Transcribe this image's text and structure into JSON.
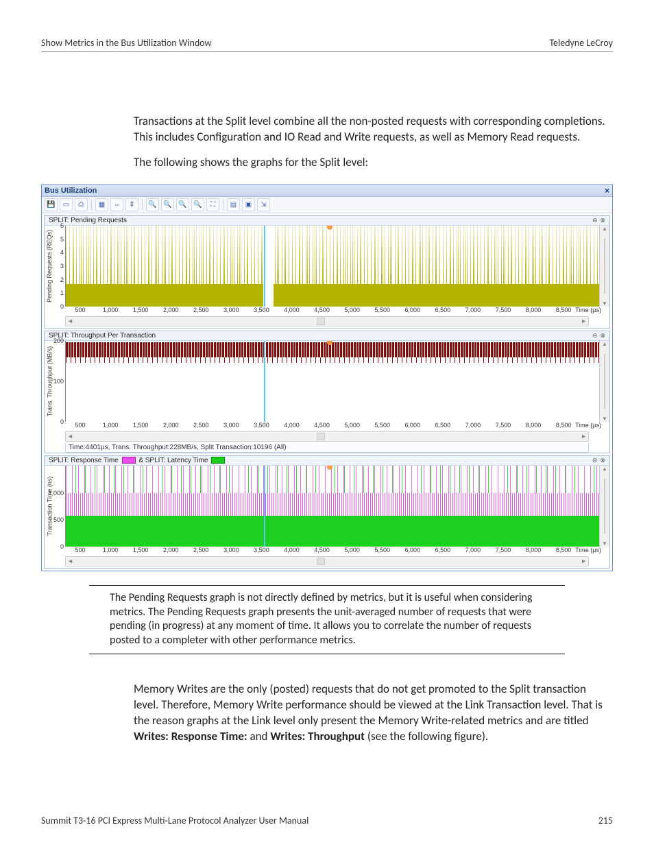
{
  "header": {
    "left": "Show Metrics in the Bus Utilization Window",
    "right": "Teledyne LeCroy"
  },
  "para1": "Transactions at the Split level combine all the non-posted requests with corresponding completions. This includes Configuration and IO Read and Write requests, as well as Memory Read requests.",
  "para2": "The following shows the graphs for the Split level:",
  "bu": {
    "window_title": "Bus Utilization",
    "toolbar_icons": [
      "save-icon",
      "rect-icon",
      "print-icon",
      "grid-icon",
      "fit-width-icon",
      "fit-height-icon",
      "zoom-in-icon",
      "zoom-out-icon",
      "zoom-select-icon",
      "zoom-reset-icon",
      "expand-icon",
      "tile-icon",
      "full-icon",
      "export-icon"
    ],
    "x_ticks": [
      "500",
      "1,000",
      "1,500",
      "2,000",
      "2,500",
      "3,000",
      "3,500",
      "4,000",
      "4,500",
      "5,000",
      "5,500",
      "6,000",
      "6,500",
      "7,000",
      "7,500",
      "8,000",
      "8,500"
    ],
    "x_label": "Time (µs)",
    "cursor_pct": 37.1,
    "marker_pct": 49.5,
    "pane1": {
      "title": "SPLIT: Pending Requests",
      "ylabel": "Pending Requests (REQs)",
      "yticks": [
        {
          "v": "0",
          "bottom": 0
        },
        {
          "v": "1",
          "bottom": 16.6
        },
        {
          "v": "2",
          "bottom": 33.3
        },
        {
          "v": "3",
          "bottom": 50
        },
        {
          "v": "4",
          "bottom": 66.6
        },
        {
          "v": "5",
          "bottom": 83.3
        },
        {
          "v": "6",
          "bottom": 100
        }
      ]
    },
    "pane2": {
      "title": "SPLIT: Throughput Per Transaction",
      "ylabel": "Trans. Throughput (MB/s)",
      "yticks": [
        {
          "v": "0",
          "bottom": 0
        },
        {
          "v": "100",
          "bottom": 50
        },
        {
          "v": "200",
          "bottom": 100
        }
      ],
      "status": "Time:4401µs, Trans. Throughput:228MB/s, Split Transaction:10196 (All)"
    },
    "pane3": {
      "title_a": "SPLIT: Response Time",
      "title_amp": " & ",
      "title_b": "SPLIT: Latency Time",
      "ylabel": "Transaction Time (ns)",
      "yticks": [
        {
          "v": "0",
          "bottom": 0
        },
        {
          "v": "500",
          "bottom": 33
        },
        {
          "v": "1,000",
          "bottom": 66
        }
      ]
    }
  },
  "note": "The Pending Requests graph is not directly defined by metrics, but it is useful when considering metrics. The Pending Requests graph presents the unit-averaged number of requests that were pending (in progress) at any moment of time. It allows you to correlate the number of requests posted to a completer with other performance metrics.",
  "para3_pre": "Memory Writes are the only (posted) requests that do not get promoted to the Split transaction level. Therefore, Memory Write performance should be viewed at the Link Transaction level. That is the reason graphs at the Link level only present the Memory Write-related metrics and are titled ",
  "para3_b1": "Writes: Response Time:",
  "para3_mid": " and ",
  "para3_b2": "Writes: Throughput",
  "para3_post": " (see the following figure).",
  "footer": {
    "left": "Summit T3-16 PCI Express Multi-Lane Protocol Analyzer User Manual",
    "right": "215"
  },
  "chart_data": [
    {
      "type": "bar",
      "title": "SPLIT: Pending Requests",
      "xlabel": "Time (µs)",
      "ylabel": "Pending Requests (REQs)",
      "xlim": [
        0,
        8800
      ],
      "ylim": [
        0,
        6
      ],
      "note": "Dense per-transaction bars; baseline ≈1 with frequent spikes to 3–6."
    },
    {
      "type": "bar",
      "title": "SPLIT: Throughput Per Transaction",
      "xlabel": "Time (µs)",
      "ylabel": "Trans. Throughput (MB/s)",
      "xlim": [
        0,
        8800
      ],
      "ylim": [
        0,
        250
      ],
      "note": "Dense band near ~200–230 MB/s; cursor at 4401µs reads 228 MB/s, transaction 10196."
    },
    {
      "type": "line",
      "title": "SPLIT: Response Time & SPLIT: Latency Time",
      "xlabel": "Time (µs)",
      "ylabel": "Transaction Time (ns)",
      "xlim": [
        0,
        8800
      ],
      "ylim": [
        0,
        1200
      ],
      "series": [
        {
          "name": "SPLIT: Response Time",
          "color": "#e94fe9",
          "note": "Mostly 300–600 ns with spikes to ~1000+."
        },
        {
          "name": "SPLIT: Latency Time",
          "color": "#1fcf1f",
          "note": "Mostly 250–400 ns baseline."
        }
      ]
    }
  ]
}
